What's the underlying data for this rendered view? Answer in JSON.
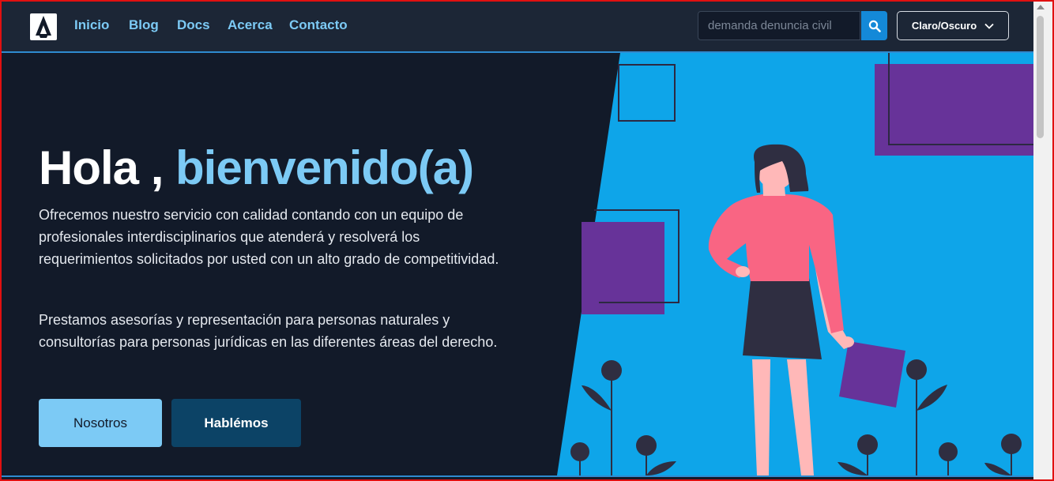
{
  "nav": {
    "logo_icon": "astro-logo-icon",
    "links": [
      "Inicio",
      "Blog",
      "Docs",
      "Acerca",
      "Contacto"
    ],
    "search": {
      "placeholder": "demanda denuncia civil",
      "button_icon": "search-icon"
    },
    "theme_toggle": {
      "label": "Claro/Oscuro",
      "icon": "chevron-down-icon"
    }
  },
  "hero": {
    "title_plain": "Hola ,",
    "title_accent": "bienvenido(a)",
    "paragraph_1": "Ofrecemos nuestro servicio con calidad contando con un equipo de profesionales interdisciplinarios que atenderá y resolverá los requerimientos solicitados por usted con un alto grado de competitividad.",
    "paragraph_2": "Prestamos asesorías y representación para personas naturales y consultorías para personas jurídicas en las diferentes áreas del derecho.",
    "buttons": {
      "primary": "Nosotros",
      "secondary": "Hablémos"
    }
  },
  "colors": {
    "background": "#121a29",
    "navbar": "#1c2636",
    "accent": "#7ccaf5",
    "illustration_blue": "#0ea5e9",
    "purple": "#673399",
    "search_button": "#1489d8",
    "secondary_button": "#0c4366",
    "shirt": "#f96583"
  }
}
